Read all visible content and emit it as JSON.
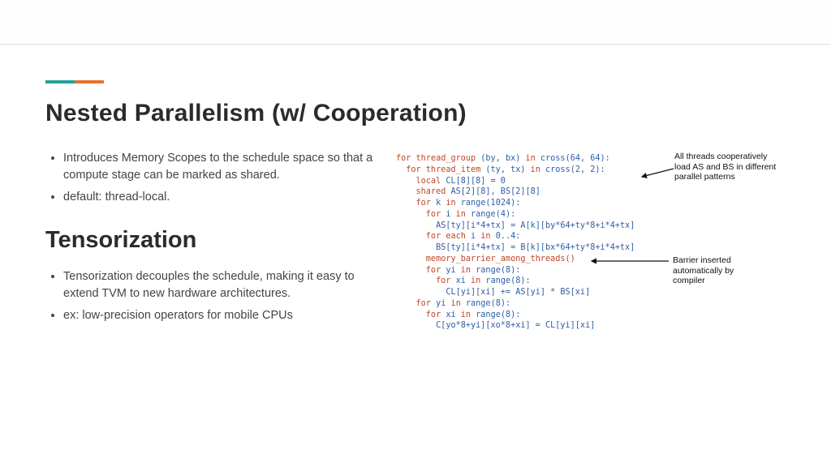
{
  "title": "Nested Parallelism (w/ Cooperation)",
  "bullets_a": [
    "Introduces Memory Scopes to the schedule space so that a compute stage can be marked as shared.",
    "default: thread-local."
  ],
  "subhead": "Tensorization",
  "bullets_b": [
    "Tensorization decouples the schedule, making it easy to extend TVM to new hardware architectures.",
    "ex: low-precision operators for mobile CPUs"
  ],
  "code": {
    "l01a": "for thread_group",
    "l01b": " (by, bx) ",
    "l01c": "in",
    "l01d": " cross(64, 64):",
    "l02a": "  for thread_item",
    "l02b": " (ty, tx) ",
    "l02c": "in",
    "l02d": " cross(2, 2):",
    "l03a": "    local",
    "l03b": " CL[8][8] = 0",
    "l04a": "    shared",
    "l04b": " AS[2][8], BS[2][8]",
    "l05a": "    for",
    "l05b": " k ",
    "l05c": "in",
    "l05d": " range(1024):",
    "l06a": "      for",
    "l06b": " i ",
    "l06c": "in",
    "l06d": " range(4):",
    "l07": "        AS[ty][i*4+tx] = A[k][by*64+ty*8+i*4+tx]",
    "l08a": "      for each",
    "l08b": " i ",
    "l08c": "in",
    "l08d": " 0..4:",
    "l09": "        BS[ty][i*4+tx] = B[k][bx*64+ty*8+i*4+tx]",
    "l10": "      memory_barrier_among_threads()",
    "l11a": "      for",
    "l11b": " yi ",
    "l11c": "in",
    "l11d": " range(8):",
    "l12a": "        for",
    "l12b": " xi ",
    "l12c": "in",
    "l12d": " range(8):",
    "l13": "          CL[yi][xi] += AS[yi] * BS[xi]",
    "l14a": "    for",
    "l14b": " yi ",
    "l14c": "in",
    "l14d": " range(8):",
    "l15a": "      for",
    "l15b": " xi ",
    "l15c": "in",
    "l15d": " range(8):",
    "l16": "        C[yo*8+yi][xo*8+xi] = CL[yi][xi]"
  },
  "annot1": "All threads cooperatively load AS and BS in different parallel patterns",
  "annot2": "Barrier inserted automatically by compiler"
}
